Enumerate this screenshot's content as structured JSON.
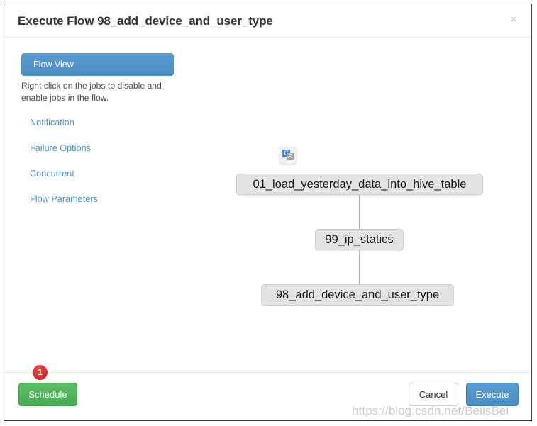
{
  "modal": {
    "title": "Execute Flow 98_add_device_and_user_type",
    "close_label": "×"
  },
  "side_panel": {
    "tab_label": "Flow View",
    "hint": "Right click on the jobs to disable and enable jobs in the flow.",
    "links": [
      {
        "label": "Notification"
      },
      {
        "label": "Failure Options"
      },
      {
        "label": "Concurrent"
      },
      {
        "label": "Flow Parameters"
      }
    ]
  },
  "graph": {
    "nodes": [
      {
        "id": "node-0",
        "label": "01_load_yesterday_data_into_hive_table"
      },
      {
        "id": "node-1",
        "label": "99_ip_statics"
      },
      {
        "id": "node-2",
        "label": "98_add_device_and_user_type"
      }
    ],
    "edges": [
      {
        "from": "node-0",
        "to": "node-1"
      },
      {
        "from": "node-1",
        "to": "node-2"
      }
    ],
    "extension_icon": {
      "name": "google-translate-icon",
      "primary_glyph": "G",
      "secondary_glyph": "文"
    }
  },
  "footer": {
    "schedule_label": "Schedule",
    "cancel_label": "Cancel",
    "execute_label": "Execute",
    "step_badge": "1"
  },
  "watermark": {
    "text": "https://blog.csdn.net/BeiisBei"
  },
  "colors": {
    "accent_blue": "#4a90c4",
    "success_green": "#4cb458",
    "badge_red": "#e02b29",
    "node_gray": "#e3e3e3"
  }
}
